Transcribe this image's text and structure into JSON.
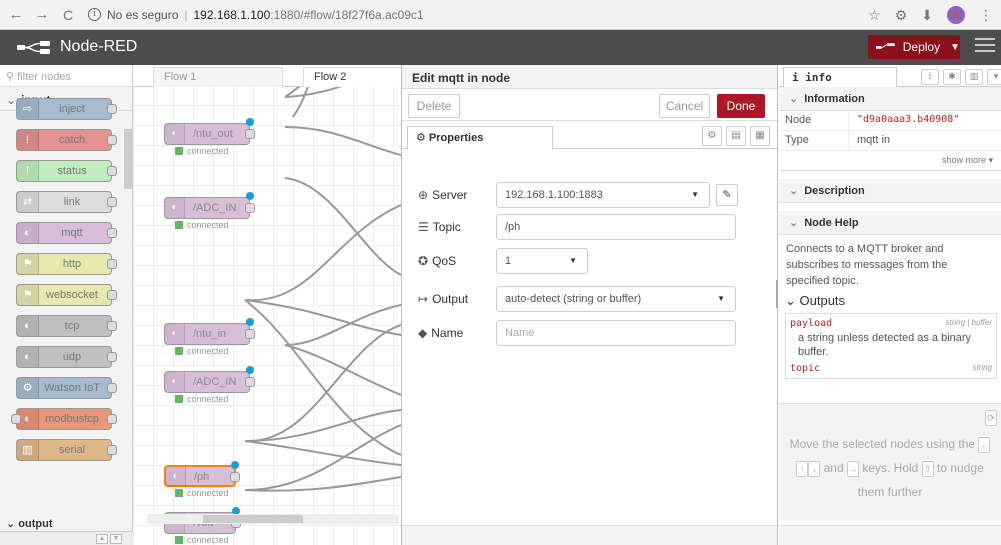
{
  "browser": {
    "back_icon": "←",
    "forward_icon": "→",
    "reload_icon": "C",
    "security_text": "No es seguro",
    "url_host": "192.168.1.100",
    "url_path": ":1880/#flow/18f27f6a.ac09c1",
    "profile_initial": "W"
  },
  "header": {
    "app_title": "Node-RED",
    "deploy_label": "Deploy"
  },
  "palette": {
    "filter_placeholder": "filter nodes",
    "category_input": "input",
    "category_output": "output",
    "nodes": [
      {
        "label": "inject",
        "color": "#a6bbcf"
      },
      {
        "label": "catch",
        "color": "#e49191"
      },
      {
        "label": "status",
        "color": "#c0edc0"
      },
      {
        "label": "link",
        "color": "#dddddd"
      },
      {
        "label": "mqtt",
        "color": "#d8bfd8"
      },
      {
        "label": "http",
        "color": "#e7e7ae"
      },
      {
        "label": "websocket",
        "color": "#e7e7ae"
      },
      {
        "label": "tcp",
        "color": "#c0c0c0"
      },
      {
        "label": "udp",
        "color": "#c0c0c0"
      },
      {
        "label": "Watson IoT",
        "color": "#a6bbcf"
      },
      {
        "label": "modbustcp",
        "color": "#e9967a"
      },
      {
        "label": "serial",
        "color": "#deb887"
      }
    ]
  },
  "workspace": {
    "tabs": [
      "Flow 1",
      "Flow 2"
    ],
    "nodes": [
      {
        "label": "/ntu_out",
        "status": "connected"
      },
      {
        "label": "/ADC_IN",
        "status": "connected"
      },
      {
        "label": "/ntu_in",
        "status": "connected"
      },
      {
        "label": "/ADC_IN",
        "status": "connected"
      },
      {
        "label": "/ph",
        "status": "connected"
      },
      {
        "label": "/volt",
        "status": "connected"
      }
    ]
  },
  "editor": {
    "title": "Edit mqtt in node",
    "delete_label": "Delete",
    "cancel_label": "Cancel",
    "done_label": "Done",
    "tab_properties": "Properties",
    "server_label": "Server",
    "server_value": "192.168.1.100:1883",
    "topic_label": "Topic",
    "topic_value": "/ph",
    "qos_label": "QoS",
    "qos_value": "1",
    "output_label": "Output",
    "output_value": "auto-detect (string or buffer)",
    "name_label": "Name",
    "name_placeholder": "Name"
  },
  "sidebar": {
    "tab_info": "info",
    "section_information": "Information",
    "info_rows": [
      {
        "key": "Node",
        "value": "\"d9a0aaa3.b40908\""
      },
      {
        "key": "Type",
        "value": "mqtt in"
      }
    ],
    "show_more": "show more ▾",
    "section_description": "Description",
    "section_node_help": "Node Help",
    "help_text": "Connects to a MQTT broker and subscribes to messages from the specified topic.",
    "outputs_heading": "Outputs",
    "outputs": [
      {
        "name": "payload",
        "type": "string | buffer",
        "desc": "a string unless detected as a binary buffer."
      },
      {
        "name": "topic",
        "type": "string",
        "desc": ""
      }
    ],
    "tip_part1": "Move the selected nodes using the",
    "tip_part2": "and",
    "tip_part3": "keys. Hold",
    "tip_part4": "to nudge them further"
  }
}
